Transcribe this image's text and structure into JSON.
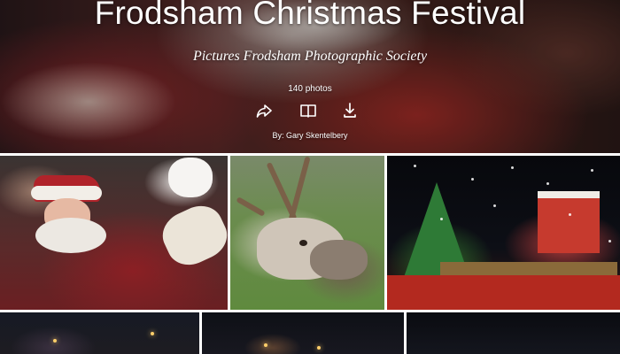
{
  "album": {
    "title": "Frodsham Christmas Festival",
    "description": "Pictures Frodsham Photographic Society",
    "photo_count": "140 photos",
    "author": "By: Gary Skentelbery"
  },
  "actions": {
    "share_icon": "share-arrow-icon",
    "slideshow_icon": "open-book-icon",
    "download_icon": "download-icon"
  },
  "photos": [
    {
      "subject": "santa"
    },
    {
      "subject": "reindeer"
    },
    {
      "subject": "christmas-float"
    },
    {
      "subject": "street-night"
    },
    {
      "subject": "street-night"
    },
    {
      "subject": "snow-night"
    }
  ],
  "colors": {
    "text": "#ffffff",
    "background": "#ffffff"
  }
}
